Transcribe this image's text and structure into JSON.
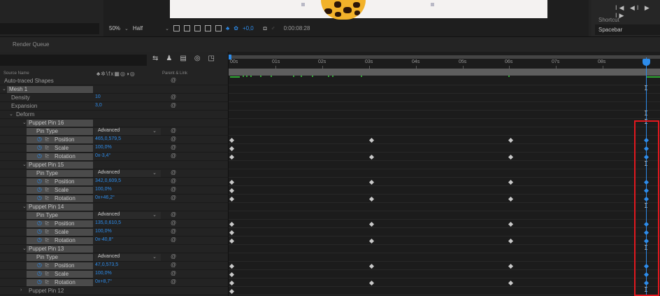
{
  "toolbar": {
    "zoom": "50%",
    "resolution": "Half",
    "exposure": "+0,0",
    "timecode": "0:00:08:28"
  },
  "shortcut": {
    "label": "Shortcut",
    "value": "Spacebar",
    "transport": "I◀ ◀I ▶ I▶"
  },
  "panel": {
    "render_queue": "Render Queue"
  },
  "layer_header": {
    "source_name": "Source Name",
    "switches": "♣✲\\fx▦◎◑◎",
    "parent_link": "Parent & Link"
  },
  "ruler": [
    "00s",
    "01s",
    "02s",
    "03s",
    "04s",
    "05s",
    "06s",
    "07s",
    "08s"
  ],
  "rows": [
    {
      "label": "Auto-traced Shapes"
    },
    {
      "label": "Mesh 1"
    },
    {
      "label": "Density",
      "value": "10"
    },
    {
      "label": "Expansion",
      "value": "3,0"
    },
    {
      "label": "Deform"
    },
    {
      "label": "Puppet Pin 16"
    },
    {
      "label": "Pin Type",
      "select": "Advanced"
    },
    {
      "label": "Position",
      "value": "465,0,579,5"
    },
    {
      "label": "Scale",
      "value": "100,0%"
    },
    {
      "label": "Rotation",
      "value": "0x-3,4°"
    },
    {
      "label": "Puppet Pin 15"
    },
    {
      "label": "Pin Type",
      "select": "Advanced"
    },
    {
      "label": "Position",
      "value": "342,0,609,5"
    },
    {
      "label": "Scale",
      "value": "100,0%"
    },
    {
      "label": "Rotation",
      "value": "0x+46,2°"
    },
    {
      "label": "Puppet Pin 14"
    },
    {
      "label": "Pin Type",
      "select": "Advanced"
    },
    {
      "label": "Position",
      "value": "135,0,610,5"
    },
    {
      "label": "Scale",
      "value": "100,0%"
    },
    {
      "label": "Rotation",
      "value": "0x-40,8°"
    },
    {
      "label": "Puppet Pin 13"
    },
    {
      "label": "Pin Type",
      "select": "Advanced"
    },
    {
      "label": "Position",
      "value": "47,0,573,5"
    },
    {
      "label": "Scale",
      "value": "100,0%"
    },
    {
      "label": "Rotation",
      "value": "0x+8,7°"
    },
    {
      "label": "Puppet Pin 12"
    }
  ],
  "colors": {
    "accent": "#2d8ceb",
    "highlight": "#e2181e",
    "cache": "#2faa34"
  }
}
